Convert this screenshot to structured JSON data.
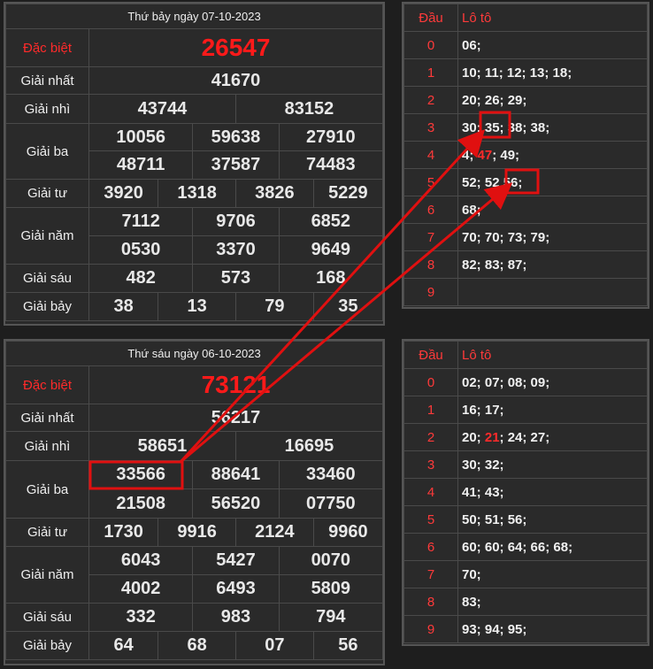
{
  "results": [
    {
      "title": "Thứ bảy ngày 07-10-2023",
      "labels": {
        "db": "Đặc biệt",
        "g1": "Giải nhất",
        "g2": "Giải nhì",
        "g3": "Giải ba",
        "g4": "Giải tư",
        "g5": "Giải năm",
        "g6": "Giải sáu",
        "g7": "Giải bảy"
      },
      "db": "26547",
      "g1": "41670",
      "g2": [
        "43744",
        "83152"
      ],
      "g3": [
        "10056",
        "59638",
        "27910",
        "48711",
        "37587",
        "74483"
      ],
      "g4": [
        "3920",
        "1318",
        "3826",
        "5229"
      ],
      "g5": [
        "7112",
        "9706",
        "6852",
        "0530",
        "3370",
        "9649"
      ],
      "g6": [
        "482",
        "573",
        "168"
      ],
      "g7": [
        "38",
        "13",
        "79",
        "35"
      ]
    },
    {
      "title": "Thứ sáu ngày 06-10-2023",
      "labels": {
        "db": "Đặc biệt",
        "g1": "Giải nhất",
        "g2": "Giải nhì",
        "g3": "Giải ba",
        "g4": "Giải tư",
        "g5": "Giải năm",
        "g6": "Giải sáu",
        "g7": "Giải bảy"
      },
      "db": "73121",
      "g1": "56217",
      "g2": [
        "58651",
        "16695"
      ],
      "g3": [
        "33566",
        "88641",
        "33460",
        "21508",
        "56520",
        "07750"
      ],
      "g4": [
        "1730",
        "9916",
        "2124",
        "9960"
      ],
      "g5": [
        "6043",
        "5427",
        "0070",
        "4002",
        "6493",
        "5809"
      ],
      "g6": [
        "332",
        "983",
        "794"
      ],
      "g7": [
        "64",
        "68",
        "07",
        "56"
      ]
    }
  ],
  "loto": [
    {
      "header": {
        "dau": "Đầu",
        "loto": "Lô tô"
      },
      "rows": [
        {
          "dau": "0",
          "values": "06;"
        },
        {
          "dau": "1",
          "values": "10; 11; 12; 13; 18;"
        },
        {
          "dau": "2",
          "values": "20; 26; 29;"
        },
        {
          "dau": "3",
          "values_a": "30; ",
          "values_hl": "35;",
          "values_b": " 38; 38;"
        },
        {
          "dau": "4",
          "values_a": "4",
          "values_hl": "47",
          "values_b": "; 49;",
          "values_pre": "; "
        },
        {
          "dau": "5",
          "values_a": "52; 52 ",
          "values_hl": "56;",
          "values_b": ""
        },
        {
          "dau": "6",
          "values": "68;"
        },
        {
          "dau": "7",
          "values": "70; 70; 73; 79;"
        },
        {
          "dau": "8",
          "values": "82; 83; 87;"
        },
        {
          "dau": "9",
          "values": ""
        }
      ]
    },
    {
      "header": {
        "dau": "Đầu",
        "loto": "Lô tô"
      },
      "rows": [
        {
          "dau": "0",
          "values": "02; 07; 08; 09;"
        },
        {
          "dau": "1",
          "values": "16; 17;"
        },
        {
          "dau": "2",
          "values_a": "20; ",
          "values_hl": "21",
          "values_b": "; 24; 27;"
        },
        {
          "dau": "3",
          "values": "30; 32;"
        },
        {
          "dau": "4",
          "values": "41; 43;"
        },
        {
          "dau": "5",
          "values": "50; 51; 56;"
        },
        {
          "dau": "6",
          "values": "60; 60; 64; 66; 68;"
        },
        {
          "dau": "7",
          "values": "70;"
        },
        {
          "dau": "8",
          "values": "83;"
        },
        {
          "dau": "9",
          "values": "93; 94; 95;"
        }
      ]
    }
  ],
  "colors": {
    "accent": "#ff1a1a",
    "annotation": "#e01010",
    "panel": "#2a2a2a"
  }
}
